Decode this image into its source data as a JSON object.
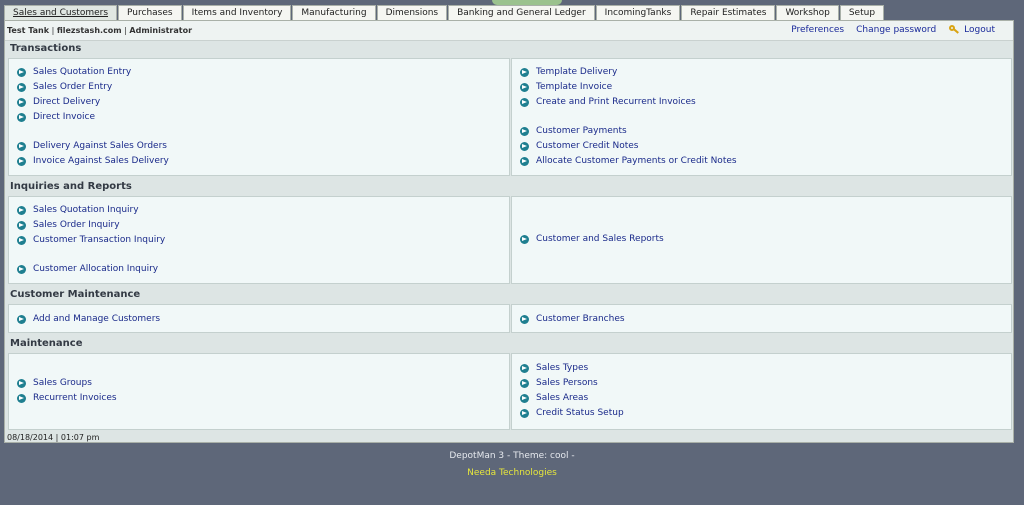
{
  "tabs": [
    "Sales and Customers",
    "Purchases",
    "Items and Inventory",
    "Manufacturing",
    "Dimensions",
    "Banking and General Ledger",
    "IncomingTanks",
    "Repair Estimates",
    "Workshop",
    "Setup"
  ],
  "user": {
    "company": "Test Tank",
    "domain": "filezstash.com",
    "role": "Administrator"
  },
  "toplinks": {
    "preferences": "Preferences",
    "change_password": "Change password",
    "logout": "Logout"
  },
  "sections": {
    "transactions": {
      "title": "Transactions",
      "left": [
        "Sales Quotation Entry",
        "Sales Order Entry",
        "Direct Delivery",
        "Direct Invoice",
        "Delivery Against Sales Orders",
        "Invoice Against Sales Delivery"
      ],
      "right": [
        "Template Delivery",
        "Template Invoice",
        "Create and Print Recurrent Invoices",
        "Customer Payments",
        "Customer Credit Notes",
        "Allocate Customer Payments or Credit Notes"
      ]
    },
    "inquiries": {
      "title": "Inquiries and Reports",
      "left": [
        "Sales Quotation Inquiry",
        "Sales Order Inquiry",
        "Customer Transaction Inquiry",
        "Customer Allocation Inquiry"
      ],
      "right": [
        "Customer and Sales Reports"
      ]
    },
    "customer_maintenance": {
      "title": "Customer Maintenance",
      "left": [
        "Add and Manage Customers"
      ],
      "right": [
        "Customer Branches"
      ]
    },
    "maintenance": {
      "title": "Maintenance",
      "left": [
        "Sales Groups",
        "Recurrent Invoices"
      ],
      "right": [
        "Sales Types",
        "Sales Persons",
        "Sales Areas",
        "Credit Status Setup"
      ]
    }
  },
  "datetime": "08/18/2014 | 01:07 pm",
  "footer": {
    "app": "DepotMan 3 - Theme: cool -",
    "vendor": "Needa Technologies"
  }
}
